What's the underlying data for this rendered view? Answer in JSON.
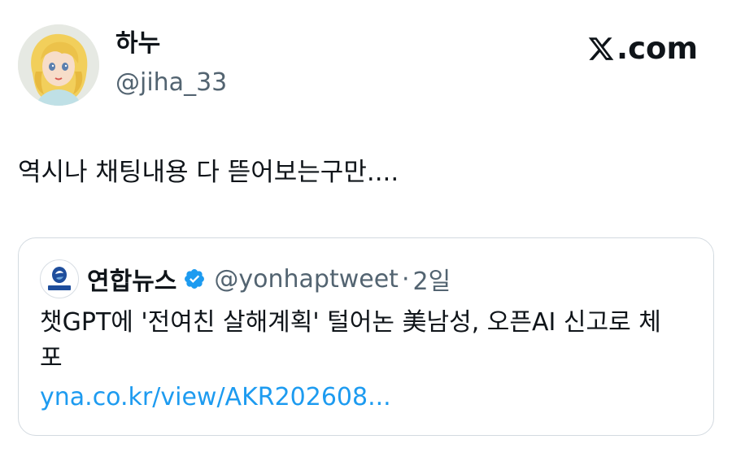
{
  "tweet": {
    "display_name": "하누",
    "handle": "@jiha_33",
    "text": "역시나 채팅내용 다 뜯어보는구만....",
    "avatar_icon": "anime-portrait-avatar"
  },
  "brand": {
    "label": ".com",
    "icon": "x-logo-icon"
  },
  "quote": {
    "display_name": "연합뉴스",
    "verified_icon": "verified-badge-icon",
    "verified_color": "#1d9bf0",
    "handle": "@yonhaptweet",
    "separator": "·",
    "time": "2일",
    "text": "챗GPT에 '전여친 살해계획' 털어논 美남성, 오픈AI 신고로 체포",
    "link": "yna.co.kr/view/AKR202608...",
    "logo_label": "연합뉴스",
    "logo_color": "#1f4e9c"
  },
  "colors": {
    "text_primary": "#0f1419",
    "text_secondary": "#536471",
    "link": "#1d9bf0",
    "border": "#d3dae0"
  }
}
